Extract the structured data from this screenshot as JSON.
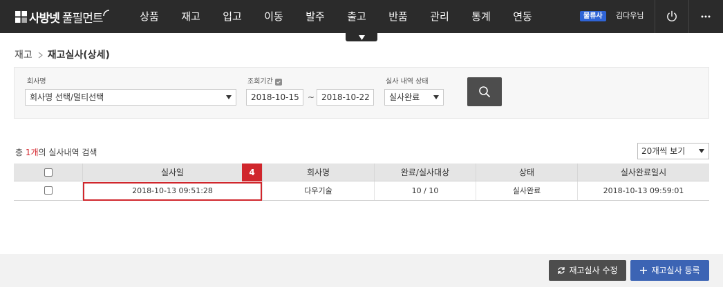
{
  "header": {
    "logo_text": "사방넷",
    "logo_sub": "풀필먼트",
    "nav": [
      "상품",
      "재고",
      "입고",
      "이동",
      "발주",
      "출고",
      "반품",
      "관리",
      "통계",
      "연동"
    ],
    "company_badge": "물류사",
    "user_name": "김다우님",
    "icons": [
      "power-icon",
      "more-icon"
    ]
  },
  "breadcrumb": {
    "parent": "재고",
    "current": "재고실사(상세)"
  },
  "filter": {
    "company_label": "회사명",
    "company_value": "회사명 선택/멀티선택",
    "period_label": "조회기간",
    "date_from": "2018-10-15",
    "date_sep": "~",
    "date_to": "2018-10-22",
    "status_label": "실사 내역 상태",
    "status_value": "실사완료"
  },
  "summary": {
    "prefix": "총 ",
    "count": "1개",
    "suffix": "의 실사내역 검색",
    "page_size": "20개씩 보기"
  },
  "table": {
    "headers": [
      "실사일",
      "회사명",
      "완료/실사대상",
      "상태",
      "실사완료일시"
    ],
    "rows": [
      {
        "date": "2018-10-13 09:51:28",
        "company": "다우기술",
        "progress": "10 / 10",
        "status": "실사완료",
        "completed_at": "2018-10-13 09:59:01"
      }
    ]
  },
  "annotation": {
    "step": "4",
    "color": "#d0262c"
  },
  "actions": {
    "edit_label": "재고실사 수정",
    "register_label": "재고실사 등록"
  },
  "colors": {
    "topbar": "#2b2b2b",
    "badge": "#2f64d6",
    "register_button": "#3c64b4",
    "edit_button": "#4d4d4d",
    "count_highlight": "#d4242b"
  }
}
